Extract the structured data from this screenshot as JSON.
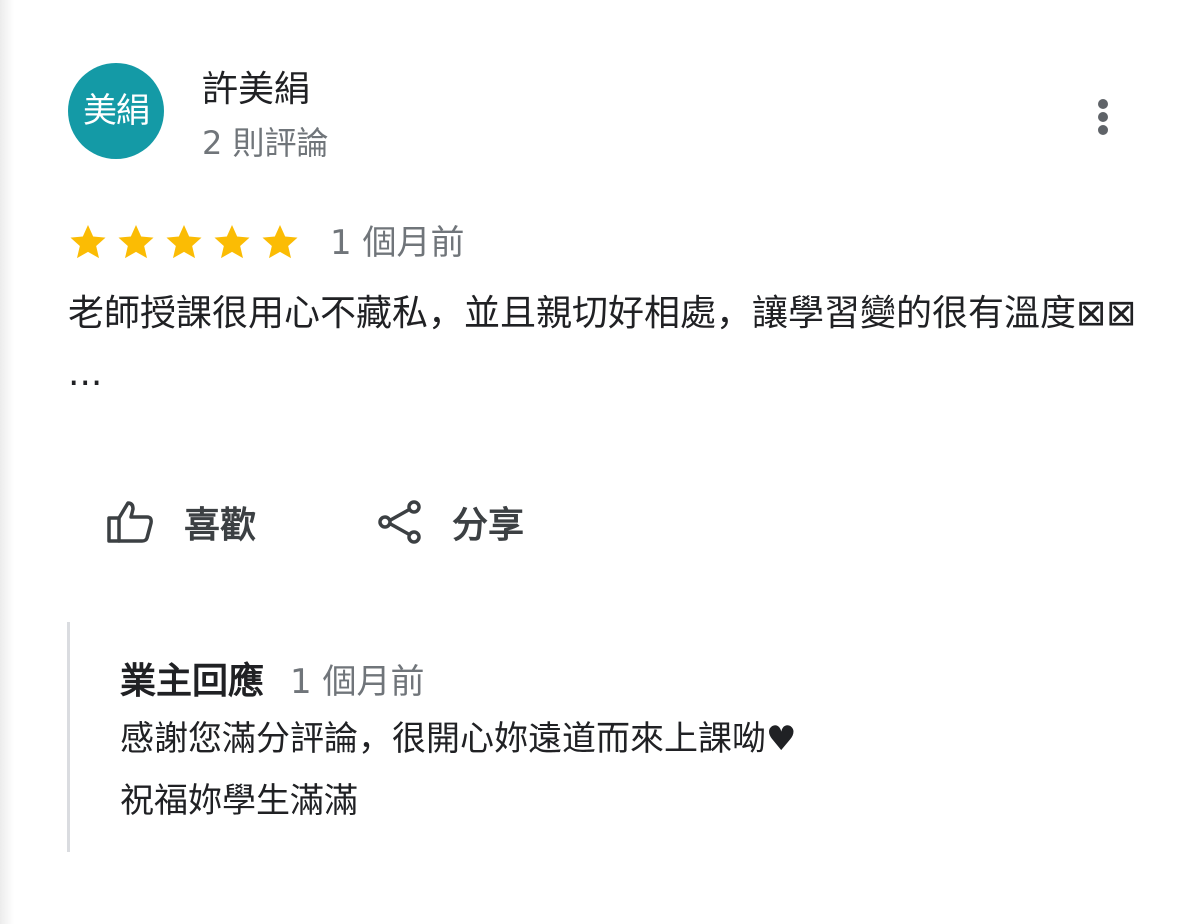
{
  "author": {
    "avatar_text": "美絹",
    "avatar_color": "#149aa6",
    "name": "許美絹",
    "review_count": "2 則評論"
  },
  "more_menu_icon": "vertical-dots-icon",
  "review": {
    "rating": 5,
    "rating_max": 5,
    "star_color": "#fbbc04",
    "date": "1 個月前",
    "text": "老師授課很用心不藏私，並且親切好相處，讓學習變的很有溫度⊠⊠ ..."
  },
  "actions": {
    "like_icon": "thumb-up-icon",
    "like_label": "喜歡",
    "share_icon": "share-icon",
    "share_label": "分享"
  },
  "owner_reply": {
    "author": "業主回應",
    "date": "1 個月前",
    "lines": [
      "感謝您滿分評論，很開心妳遠道而來上課呦♥",
      "祝福妳學生滿滿"
    ]
  }
}
